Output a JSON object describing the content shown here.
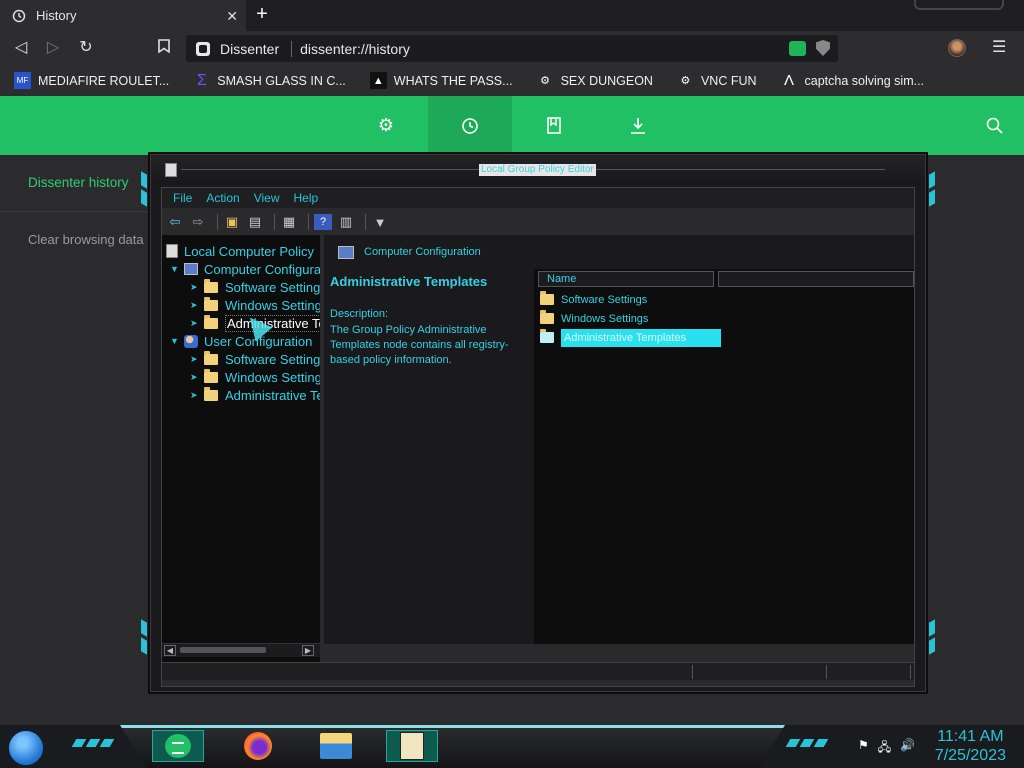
{
  "browser": {
    "tab_title": "History",
    "tab_close": "✕",
    "new_tab": "+",
    "site_name": "Dissenter",
    "url": "dissenter://history",
    "bookmarks": [
      {
        "label": "MEDIAFIRE ROULET...",
        "icon": "mediafire-icon"
      },
      {
        "label": "SMASH GLASS IN C...",
        "icon": "sigma-icon"
      },
      {
        "label": "WHATS THE PASS...",
        "icon": "doc-icon"
      },
      {
        "label": "SEX DUNGEON",
        "icon": "vnc-icon"
      },
      {
        "label": "VNC FUN",
        "icon": "vnc-icon"
      },
      {
        "label": "captcha solving sim...",
        "icon": "lambda-icon"
      }
    ]
  },
  "dissenter": {
    "side_title": "Dissenter history",
    "clear_label": "Clear browsing data"
  },
  "gp_editor": {
    "title": "Local Group Policy Editor",
    "menu": [
      "File",
      "Action",
      "View",
      "Help"
    ],
    "tree": {
      "root": "Local Computer Policy",
      "computer_config": "Computer Configuration",
      "user_config": "User Configuration",
      "software": "Software Settings",
      "windows": "Windows Settings",
      "admin": "Administrative Templates"
    },
    "right_header": "Computer Configuration",
    "desc_title": "Administrative Templates",
    "desc_label": "Description:",
    "desc_text": "The Group Policy Administrative Templates node contains all registry-based policy information.",
    "col_name": "Name",
    "list": [
      "Software Settings",
      "Windows Settings",
      "Administrative Templates"
    ]
  },
  "taskbar": {
    "time": "11:41 AM",
    "date": "7/25/2023"
  },
  "colors": {
    "accent_green": "#22c064",
    "accent_cyan": "#29c3d6"
  }
}
